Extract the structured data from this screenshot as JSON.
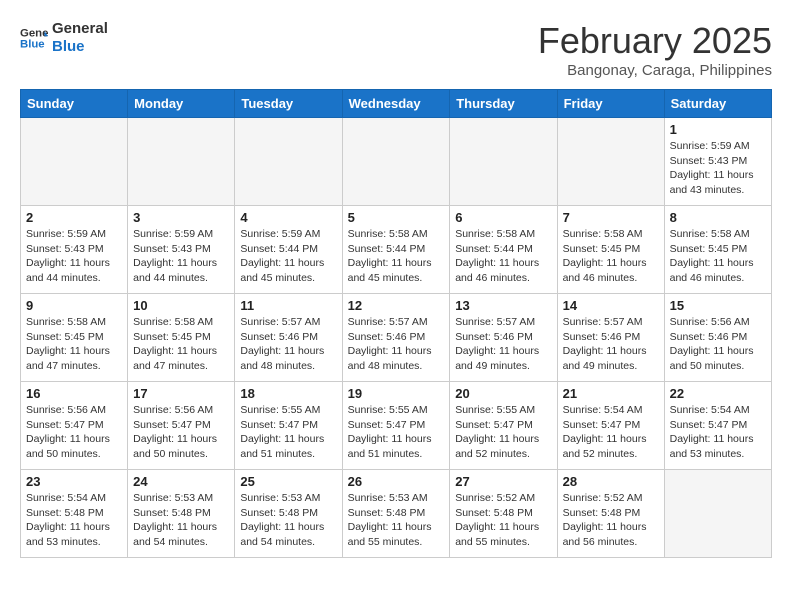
{
  "header": {
    "logo_line1": "General",
    "logo_line2": "Blue",
    "month": "February 2025",
    "location": "Bangonay, Caraga, Philippines"
  },
  "days_of_week": [
    "Sunday",
    "Monday",
    "Tuesday",
    "Wednesday",
    "Thursday",
    "Friday",
    "Saturday"
  ],
  "weeks": [
    [
      {
        "day": "",
        "info": ""
      },
      {
        "day": "",
        "info": ""
      },
      {
        "day": "",
        "info": ""
      },
      {
        "day": "",
        "info": ""
      },
      {
        "day": "",
        "info": ""
      },
      {
        "day": "",
        "info": ""
      },
      {
        "day": "1",
        "info": "Sunrise: 5:59 AM\nSunset: 5:43 PM\nDaylight: 11 hours\nand 43 minutes."
      }
    ],
    [
      {
        "day": "2",
        "info": "Sunrise: 5:59 AM\nSunset: 5:43 PM\nDaylight: 11 hours\nand 44 minutes."
      },
      {
        "day": "3",
        "info": "Sunrise: 5:59 AM\nSunset: 5:43 PM\nDaylight: 11 hours\nand 44 minutes."
      },
      {
        "day": "4",
        "info": "Sunrise: 5:59 AM\nSunset: 5:44 PM\nDaylight: 11 hours\nand 45 minutes."
      },
      {
        "day": "5",
        "info": "Sunrise: 5:58 AM\nSunset: 5:44 PM\nDaylight: 11 hours\nand 45 minutes."
      },
      {
        "day": "6",
        "info": "Sunrise: 5:58 AM\nSunset: 5:44 PM\nDaylight: 11 hours\nand 46 minutes."
      },
      {
        "day": "7",
        "info": "Sunrise: 5:58 AM\nSunset: 5:45 PM\nDaylight: 11 hours\nand 46 minutes."
      },
      {
        "day": "8",
        "info": "Sunrise: 5:58 AM\nSunset: 5:45 PM\nDaylight: 11 hours\nand 46 minutes."
      }
    ],
    [
      {
        "day": "9",
        "info": "Sunrise: 5:58 AM\nSunset: 5:45 PM\nDaylight: 11 hours\nand 47 minutes."
      },
      {
        "day": "10",
        "info": "Sunrise: 5:58 AM\nSunset: 5:45 PM\nDaylight: 11 hours\nand 47 minutes."
      },
      {
        "day": "11",
        "info": "Sunrise: 5:57 AM\nSunset: 5:46 PM\nDaylight: 11 hours\nand 48 minutes."
      },
      {
        "day": "12",
        "info": "Sunrise: 5:57 AM\nSunset: 5:46 PM\nDaylight: 11 hours\nand 48 minutes."
      },
      {
        "day": "13",
        "info": "Sunrise: 5:57 AM\nSunset: 5:46 PM\nDaylight: 11 hours\nand 49 minutes."
      },
      {
        "day": "14",
        "info": "Sunrise: 5:57 AM\nSunset: 5:46 PM\nDaylight: 11 hours\nand 49 minutes."
      },
      {
        "day": "15",
        "info": "Sunrise: 5:56 AM\nSunset: 5:46 PM\nDaylight: 11 hours\nand 50 minutes."
      }
    ],
    [
      {
        "day": "16",
        "info": "Sunrise: 5:56 AM\nSunset: 5:47 PM\nDaylight: 11 hours\nand 50 minutes."
      },
      {
        "day": "17",
        "info": "Sunrise: 5:56 AM\nSunset: 5:47 PM\nDaylight: 11 hours\nand 50 minutes."
      },
      {
        "day": "18",
        "info": "Sunrise: 5:55 AM\nSunset: 5:47 PM\nDaylight: 11 hours\nand 51 minutes."
      },
      {
        "day": "19",
        "info": "Sunrise: 5:55 AM\nSunset: 5:47 PM\nDaylight: 11 hours\nand 51 minutes."
      },
      {
        "day": "20",
        "info": "Sunrise: 5:55 AM\nSunset: 5:47 PM\nDaylight: 11 hours\nand 52 minutes."
      },
      {
        "day": "21",
        "info": "Sunrise: 5:54 AM\nSunset: 5:47 PM\nDaylight: 11 hours\nand 52 minutes."
      },
      {
        "day": "22",
        "info": "Sunrise: 5:54 AM\nSunset: 5:47 PM\nDaylight: 11 hours\nand 53 minutes."
      }
    ],
    [
      {
        "day": "23",
        "info": "Sunrise: 5:54 AM\nSunset: 5:48 PM\nDaylight: 11 hours\nand 53 minutes."
      },
      {
        "day": "24",
        "info": "Sunrise: 5:53 AM\nSunset: 5:48 PM\nDaylight: 11 hours\nand 54 minutes."
      },
      {
        "day": "25",
        "info": "Sunrise: 5:53 AM\nSunset: 5:48 PM\nDaylight: 11 hours\nand 54 minutes."
      },
      {
        "day": "26",
        "info": "Sunrise: 5:53 AM\nSunset: 5:48 PM\nDaylight: 11 hours\nand 55 minutes."
      },
      {
        "day": "27",
        "info": "Sunrise: 5:52 AM\nSunset: 5:48 PM\nDaylight: 11 hours\nand 55 minutes."
      },
      {
        "day": "28",
        "info": "Sunrise: 5:52 AM\nSunset: 5:48 PM\nDaylight: 11 hours\nand 56 minutes."
      },
      {
        "day": "",
        "info": ""
      }
    ]
  ]
}
